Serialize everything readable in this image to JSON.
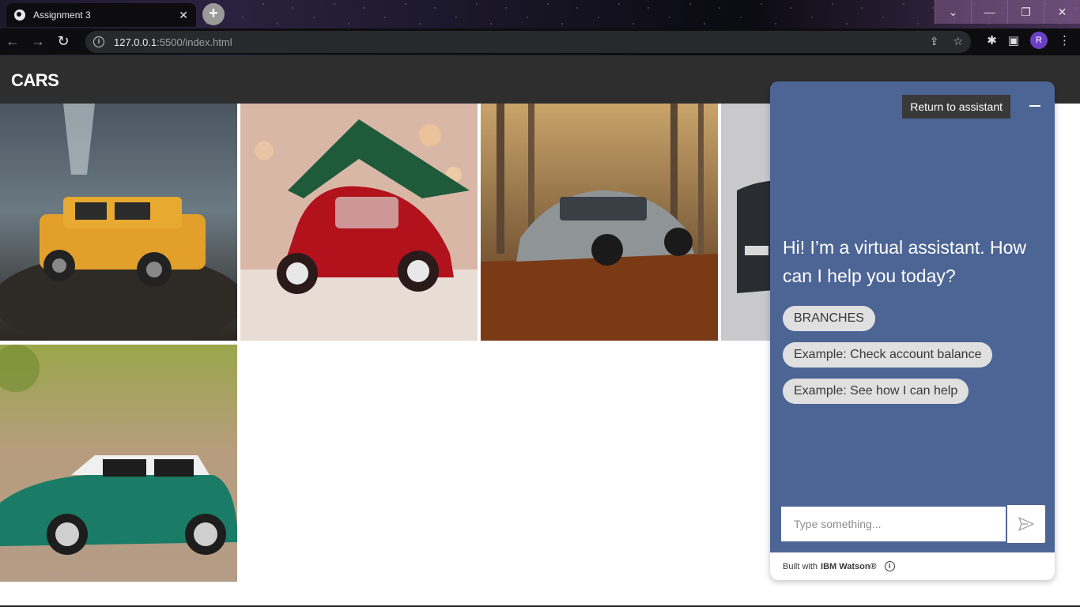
{
  "browser": {
    "tab_title": "Assignment 3",
    "url_host": "127.0.0.1",
    "url_path": ":5500/index.html",
    "profile_initial": "R"
  },
  "page": {
    "title": "CARS",
    "images": [
      {
        "alt": "yellow toy hummer in water"
      },
      {
        "alt": "red toy beetle with christmas tree"
      },
      {
        "alt": "grey BMW in autumn forest"
      },
      {
        "alt": "dark car partial"
      },
      {
        "alt": "green toy mini cooper"
      }
    ]
  },
  "assistant": {
    "return_label": "Return to assistant",
    "greeting": "Hi! I’m a virtual assistant. How can I help you today?",
    "chips": [
      "BRANCHES",
      "Example: Check account balance",
      "Example: See how I can help"
    ],
    "input_placeholder": "Type something...",
    "footer_prefix": "Built with",
    "footer_brand": "IBM Watson®",
    "panel_color": "#4d6594"
  }
}
